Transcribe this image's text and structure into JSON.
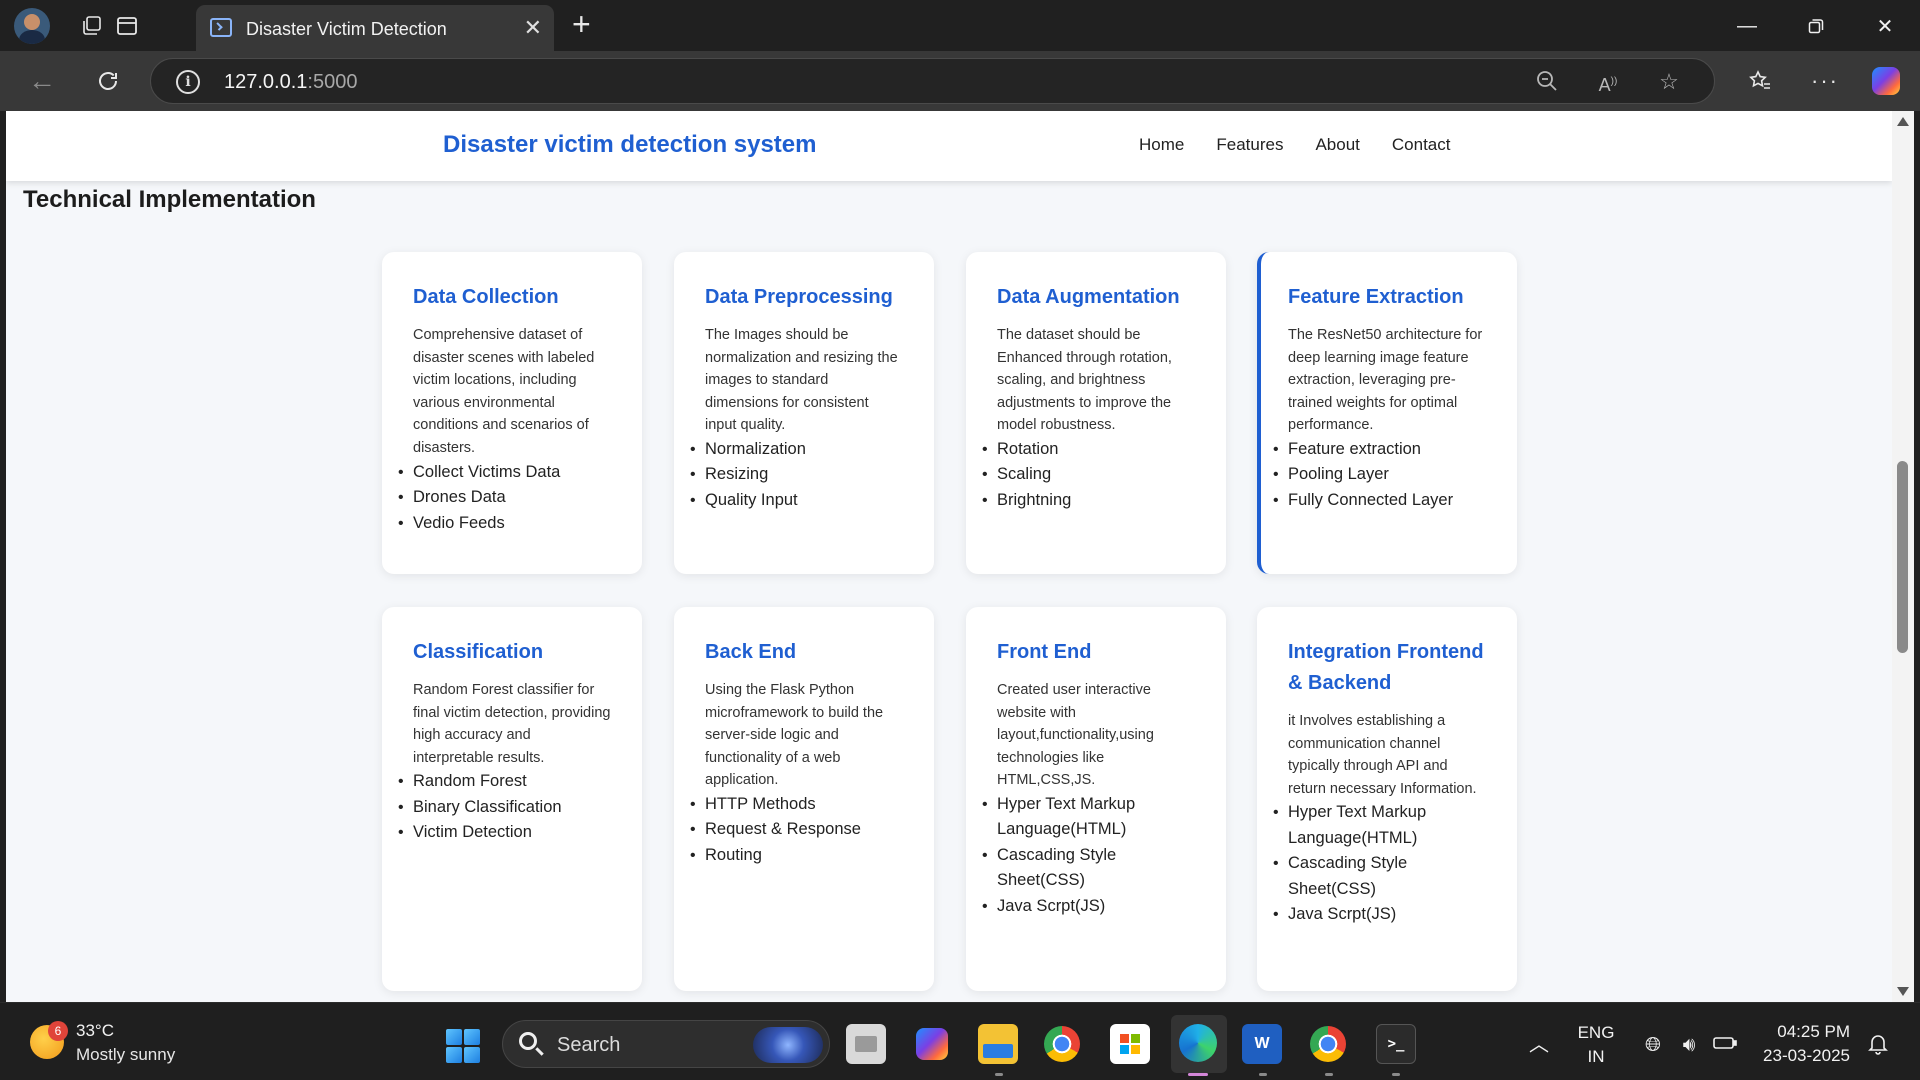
{
  "browser": {
    "tab_title": "Disaster Victim Detection",
    "url_host": "127.0.0.1",
    "url_port": ":5000"
  },
  "site": {
    "brand": "Disaster victim detection system",
    "nav": [
      "Home",
      "Features",
      "About",
      "Contact"
    ],
    "section_title": "Technical Implementation",
    "accent_color": "#1f5fd1"
  },
  "cards": [
    {
      "title": "Data Collection",
      "desc": "Comprehensive dataset of disaster scenes with labeled victim locations, including various environmental conditions and scenarios of disasters.",
      "items": [
        "Collect Victims Data",
        "Drones Data",
        "Vedio Feeds"
      ]
    },
    {
      "title": "Data Preprocessing",
      "desc": "The Images should be normalization and resizing the images to standard dimensions for consistent input quality.",
      "items": [
        "Normalization",
        "Resizing",
        "Quality Input"
      ]
    },
    {
      "title": "Data Augmentation",
      "desc": "The dataset should be Enhanced through rotation, scaling, and brightness adjustments to improve the model robustness.",
      "items": [
        "Rotation",
        "Scaling",
        "Brightning"
      ]
    },
    {
      "title": "Feature Extraction",
      "desc": "The ResNet50 architecture for deep learning image feature extraction, leveraging pre-trained weights for optimal performance.",
      "items": [
        "Feature extraction",
        "Pooling Layer",
        "Fully Connected Layer"
      ]
    },
    {
      "title": "Classification",
      "desc": "Random Forest classifier for final victim detection, providing high accuracy and interpretable results.",
      "items": [
        "Random Forest",
        "Binary Classification",
        "Victim Detection"
      ]
    },
    {
      "title": "Back End",
      "desc": "Using the Flask Python microframework to build the server-side logic and functionality of a web application.",
      "items": [
        "HTTP Methods",
        "Request & Response",
        "Routing"
      ]
    },
    {
      "title": "Front End",
      "desc": "Created user interactive website with layout,functionality,using technologies like HTML,CSS,JS.",
      "items": [
        "Hyper Text Markup Language(HTML)",
        "Cascading Style Sheet(CSS)",
        "Java Scrpt(JS)"
      ]
    },
    {
      "title": "Integration Frontend & Backend",
      "desc": "it Involves establishing a communication channel typically through API and return necessary Information.",
      "items": [
        "Hyper Text Markup Language(HTML)",
        "Cascading Style Sheet(CSS)",
        "Java Scrpt(JS)"
      ]
    }
  ],
  "taskbar": {
    "weather_badge": "6",
    "weather_temp": "33°C",
    "weather_desc": "Mostly sunny",
    "search_label": "Search",
    "lang_top": "ENG",
    "lang_bottom": "IN",
    "time": "04:25 PM",
    "date": "23-03-2025",
    "app_word_label": "W"
  }
}
